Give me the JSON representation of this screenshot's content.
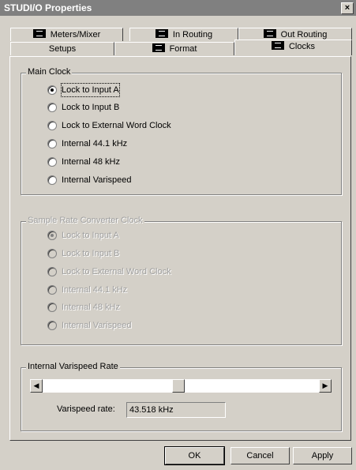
{
  "window": {
    "title": "STUDI/O Properties",
    "close_glyph": "×"
  },
  "tabs": {
    "row1": [
      {
        "label": "Meters/Mixer",
        "icon": "device-icon"
      },
      {
        "label": "In Routing",
        "icon": "device-icon"
      },
      {
        "label": "Out Routing",
        "icon": "device-icon"
      }
    ],
    "row2": [
      {
        "label": "Setups",
        "icon": ""
      },
      {
        "label": "Format",
        "icon": "device-icon"
      },
      {
        "label": "Clocks",
        "icon": "device-icon",
        "active": true
      }
    ]
  },
  "main_clock": {
    "label": "Main Clock",
    "options": [
      {
        "label": "Lock to Input A",
        "checked": true
      },
      {
        "label": "Lock to Input B",
        "checked": false
      },
      {
        "label": "Lock to External Word Clock",
        "checked": false
      },
      {
        "label": "Internal 44.1 kHz",
        "checked": false
      },
      {
        "label": "Internal 48 kHz",
        "checked": false
      },
      {
        "label": "Internal Varispeed",
        "checked": false
      }
    ]
  },
  "src_clock": {
    "label": "Sample Rate Converter Clock",
    "disabled": true,
    "options": [
      {
        "label": "Lock to Input A",
        "checked": true
      },
      {
        "label": "Lock to Input B",
        "checked": false
      },
      {
        "label": "Lock to External Word Clock",
        "checked": false
      },
      {
        "label": "Internal 44.1 kHz",
        "checked": false
      },
      {
        "label": "Internal 48 kHz",
        "checked": false
      },
      {
        "label": "Internal Varispeed",
        "checked": false
      }
    ]
  },
  "varispeed": {
    "label": "Internal Varispeed Rate",
    "slider_position_fraction": 0.49,
    "rate_label": "Varispeed rate:",
    "rate_value": "43.518 kHz",
    "left_arrow": "◀",
    "right_arrow": "▶"
  },
  "buttons": {
    "ok": "OK",
    "cancel": "Cancel",
    "apply": "Apply"
  },
  "colors": {
    "face": "#d4d0c8",
    "titlebar": "#808080"
  }
}
